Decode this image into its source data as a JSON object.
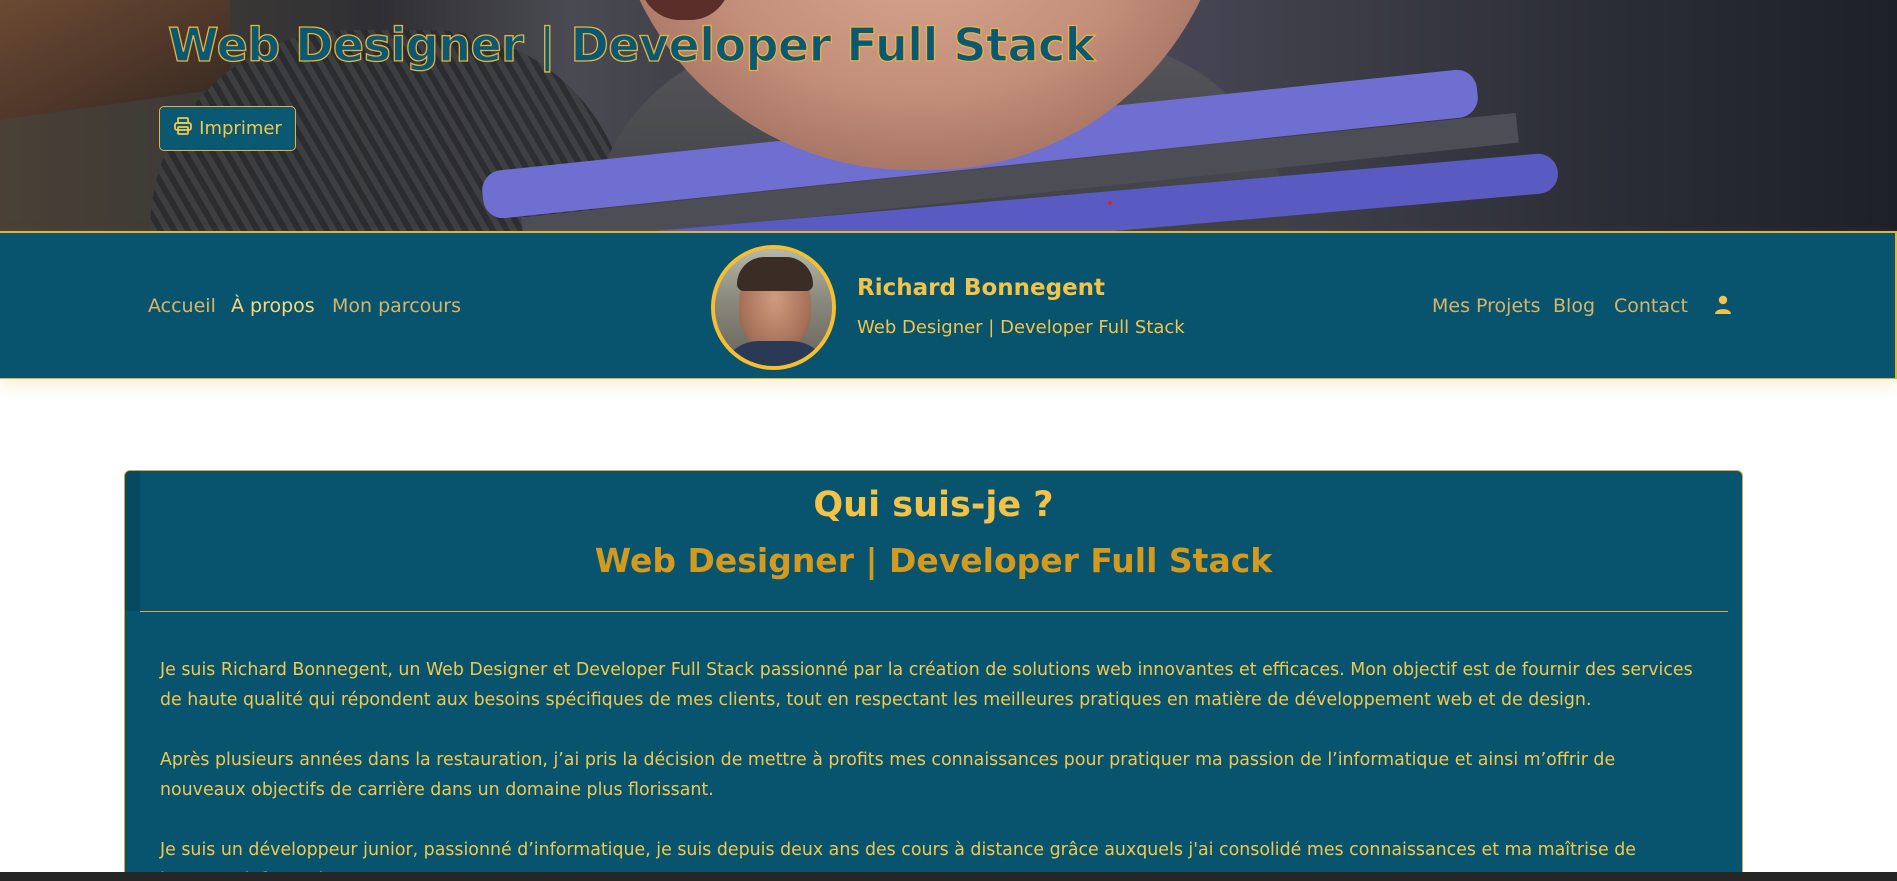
{
  "hero": {
    "title": "Web Designer | Developer Full Stack",
    "print_label": "Imprimer",
    "print_icon": "printer-icon"
  },
  "navbar": {
    "left_links": [
      "Accueil",
      "À propos",
      "Mon parcours"
    ],
    "active_link": "À propos",
    "brand_name": "Richard Bonnegent",
    "brand_subtitle": "Web Designer | Developer Full Stack",
    "right_links": [
      "Mes Projets",
      "Blog",
      "Contact"
    ],
    "user_icon": "user-icon"
  },
  "about": {
    "title": "Qui suis-je ?",
    "subtitle": "Web Designer | Developer Full Stack",
    "paragraphs": [
      "Je suis Richard Bonnegent, un Web Designer et Developer Full Stack passionné par la création de solutions web innovantes et efficaces. Mon objectif est de fournir des services de haute qualité qui répondent aux besoins spécifiques de mes clients, tout en respectant les meilleures pratiques en matière de développement web et de design.",
      "Après plusieurs années dans la restauration, j’ai pris la décision de mettre à profits mes connaissances pour pratiquer ma passion de l’informatique et ainsi m’offrir de nouveaux objectifs de carrière dans un domaine plus florissant.",
      "Je suis un développeur junior, passionné d’informatique, je suis depuis deux ans des cours à distance grâce auxquels j'ai consolidé mes connaissances et ma maîtrise de langages informatiques."
    ]
  },
  "colors": {
    "primary": "#08546e",
    "accent": "#f2c44a",
    "accent_dark": "#d39a1e",
    "muted_link": "#d6b46a"
  }
}
